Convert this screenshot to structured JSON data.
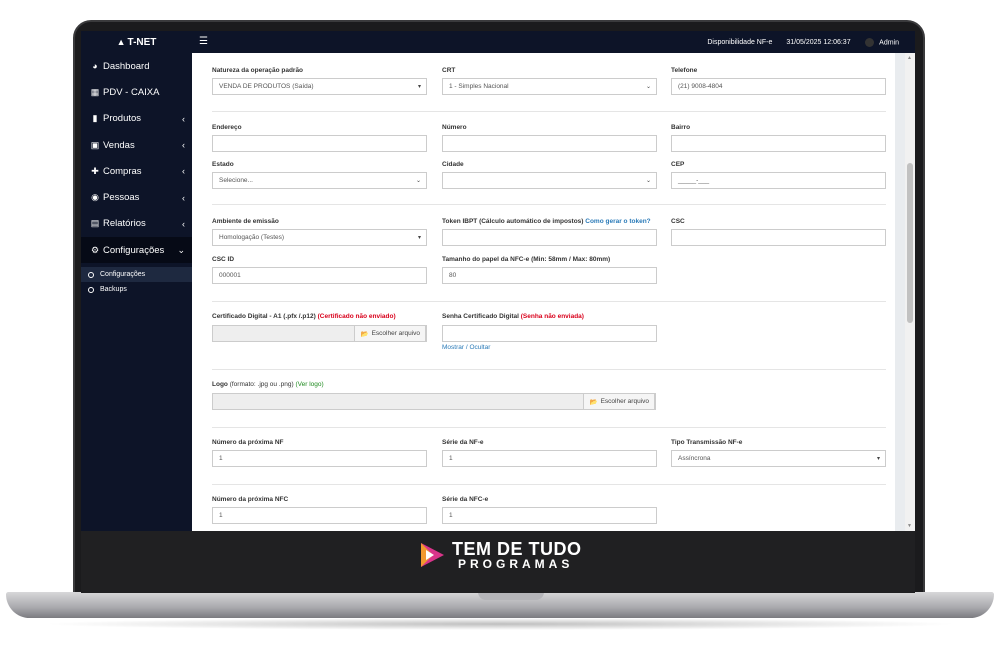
{
  "app": {
    "brand": "T-NET",
    "brand_icon": "fire-icon"
  },
  "topbar": {
    "menu_icon": "menu-icon",
    "nfe_status": "Disponibilidade NF-e",
    "datetime": "31/05/2025 12:06:37",
    "user": "Admin"
  },
  "sidebar": {
    "items": [
      {
        "label": "Dashboard",
        "icon": "dashboard-icon",
        "chevron": false
      },
      {
        "label": "PDV - CAIXA",
        "icon": "grid-icon",
        "chevron": false
      },
      {
        "label": "Produtos",
        "icon": "barcode-icon",
        "chevron": true
      },
      {
        "label": "Vendas",
        "icon": "cart-icon",
        "chevron": true
      },
      {
        "label": "Compras",
        "icon": "plus-icon",
        "chevron": true
      },
      {
        "label": "Pessoas",
        "icon": "users-icon",
        "chevron": true
      },
      {
        "label": "Relatórios",
        "icon": "chart-icon",
        "chevron": true
      },
      {
        "label": "Configurações",
        "icon": "cogs-icon",
        "chevron": true
      }
    ],
    "subitems": [
      {
        "label": "Configurações"
      },
      {
        "label": "Backups"
      }
    ]
  },
  "form": {
    "natureza": {
      "label": "Natureza da operação padrão",
      "value": "VENDA DE PRODUTOS (Saída)"
    },
    "crt": {
      "label": "CRT",
      "value": "1 - Simples Nacional"
    },
    "telefone": {
      "label": "Telefone",
      "value": "(21) 9008-4804"
    },
    "endereco": {
      "label": "Endereço",
      "value": ""
    },
    "numero": {
      "label": "Número",
      "value": ""
    },
    "bairro": {
      "label": "Bairro",
      "value": ""
    },
    "estado": {
      "label": "Estado",
      "value": "Selecione..."
    },
    "cidade": {
      "label": "Cidade",
      "value": ""
    },
    "cep": {
      "label": "CEP",
      "value": "_____-___"
    },
    "ambiente": {
      "label": "Ambiente de emissão",
      "value": "Homologação (Testes)"
    },
    "token": {
      "label": "Token IBPT (Cálculo automático de impostos)",
      "link": "Como gerar o token?",
      "value": ""
    },
    "csc": {
      "label": "CSC",
      "value": ""
    },
    "csc_id": {
      "label": "CSC ID",
      "value": "000001"
    },
    "papel": {
      "label": "Tamanho do papel da NFC-e (Min: 58mm / Max: 80mm)",
      "value": "80"
    },
    "certificado": {
      "label": "Certificado Digital - A1 (.pfx /.p12)",
      "status": "(Certificado não enviado)",
      "button": "Escolher arquivo"
    },
    "senha_cert": {
      "label": "Senha Certificado Digital",
      "status": "(Senha não enviada)",
      "toggle": "Mostrar / Ocultar",
      "value": ""
    },
    "logo": {
      "label": "Logo",
      "hint": "(formato: .jpg ou .png)",
      "link": "(Ver logo)",
      "button": "Escolher arquivo"
    },
    "prox_nf": {
      "label": "Número da próxima NF",
      "value": "1"
    },
    "serie_nfe": {
      "label": "Série da NF-e",
      "value": "1"
    },
    "tipo_trans": {
      "label": "Tipo Transmissão NF-e",
      "value": "Assíncrona"
    },
    "prox_nfc": {
      "label": "Número da próxima NFC",
      "value": "1"
    },
    "serie_nfce": {
      "label": "Série da NFC-e",
      "value": "1"
    }
  },
  "promo": {
    "line1": "TEM DE TUDO",
    "line2": "PROGRAMAS"
  }
}
